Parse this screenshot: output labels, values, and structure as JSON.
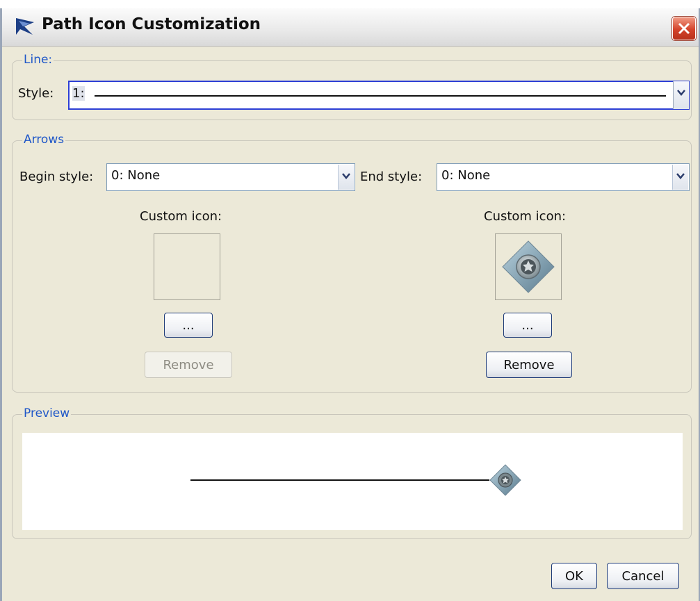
{
  "window": {
    "title": "Path Icon Customization"
  },
  "line_group": {
    "legend": "Line:",
    "style_label": "Style:",
    "style_index": "1:"
  },
  "arrows_group": {
    "legend": "Arrows",
    "begin_label": "Begin style:",
    "begin_value": "0: None",
    "end_label": "End style:",
    "end_value": "0: None",
    "begin_custom_label": "Custom icon:",
    "end_custom_label": "Custom icon:",
    "browse_label": "...",
    "remove_label": "Remove"
  },
  "preview_group": {
    "legend": "Preview"
  },
  "footer": {
    "ok_label": "OK",
    "cancel_label": "Cancel"
  },
  "colors": {
    "accent": "#1f57c8",
    "dialog_bg": "#ece9d8",
    "close": "#d4432b"
  },
  "icons": [
    "app-icon",
    "close-icon",
    "dropdown-arrow-icon",
    "star-diamond-icon"
  ]
}
